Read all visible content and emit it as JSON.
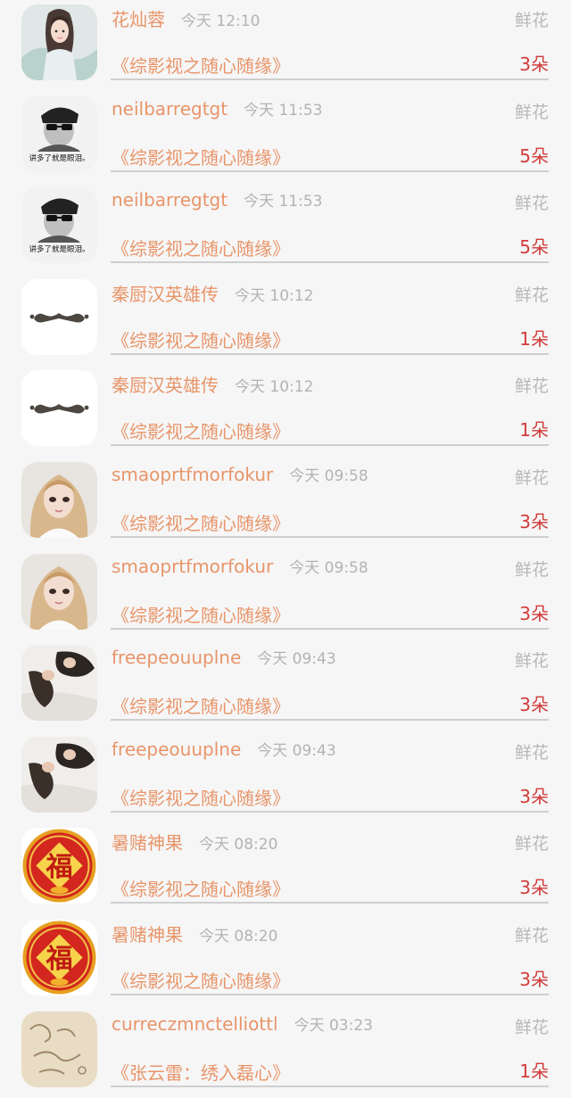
{
  "rows": [
    {
      "name": "花灿蓉",
      "time": "今天 12:10",
      "gift": "鲜花",
      "book": "《综影视之随心随缘》",
      "count": "3朵",
      "avatar": "girl-icon"
    },
    {
      "name": "neilbarregtgt",
      "time": "今天 11:53",
      "gift": "鲜花",
      "book": "《综影视之随心随缘》",
      "count": "5朵",
      "avatar": "bw-portrait-icon",
      "avatar_caption": "讲多了就是眼泪。"
    },
    {
      "name": "neilbarregtgt",
      "time": "今天 11:53",
      "gift": "鲜花",
      "book": "《综影视之随心随缘》",
      "count": "5朵",
      "avatar": "bw-portrait-icon",
      "avatar_caption": "讲多了就是眼泪。"
    },
    {
      "name": "秦厨汉英雄传",
      "time": "今天 10:12",
      "gift": "鲜花",
      "book": "《综影视之随心随缘》",
      "count": "1朵",
      "avatar": "mustache-icon"
    },
    {
      "name": "秦厨汉英雄传",
      "time": "今天 10:12",
      "gift": "鲜花",
      "book": "《综影视之随心随缘》",
      "count": "1朵",
      "avatar": "mustache-icon"
    },
    {
      "name": "smaoprtfmorfokur",
      "time": "今天 09:58",
      "gift": "鲜花",
      "book": "《综影视之随心随缘》",
      "count": "3朵",
      "avatar": "blonde-selfie-icon"
    },
    {
      "name": "smaoprtfmorfokur",
      "time": "今天 09:58",
      "gift": "鲜花",
      "book": "《综影视之随心随缘》",
      "count": "3朵",
      "avatar": "blonde-selfie-icon"
    },
    {
      "name": "freepeouuplne",
      "time": "今天 09:43",
      "gift": "鲜花",
      "book": "《综影视之随心随缘》",
      "count": "3朵",
      "avatar": "lying-figure-icon"
    },
    {
      "name": "freepeouuplne",
      "time": "今天 09:43",
      "gift": "鲜花",
      "book": "《综影视之随心随缘》",
      "count": "3朵",
      "avatar": "lying-figure-icon"
    },
    {
      "name": "暑赌神果",
      "time": "今天 08:20",
      "gift": "鲜花",
      "book": "《综影视之随心随缘》",
      "count": "3朵",
      "avatar": "fu-character-icon",
      "avatar_caption": "福"
    },
    {
      "name": "暑赌神果",
      "time": "今天 08:20",
      "gift": "鲜花",
      "book": "《综影视之随心随缘》",
      "count": "3朵",
      "avatar": "fu-character-icon",
      "avatar_caption": "福"
    },
    {
      "name": "curreczmnctelliottl",
      "time": "今天 03:23",
      "gift": "鲜花",
      "book": "《张云雷：绣入磊心》",
      "count": "1朵",
      "avatar": "sand-writing-icon"
    }
  ],
  "colors": {
    "background": "#f6f6f6",
    "name": "#e8956a",
    "time": "#b3b3b3",
    "gift": "#b8b8b8",
    "count": "#d23b3b",
    "divider": "#cfcfcf"
  }
}
